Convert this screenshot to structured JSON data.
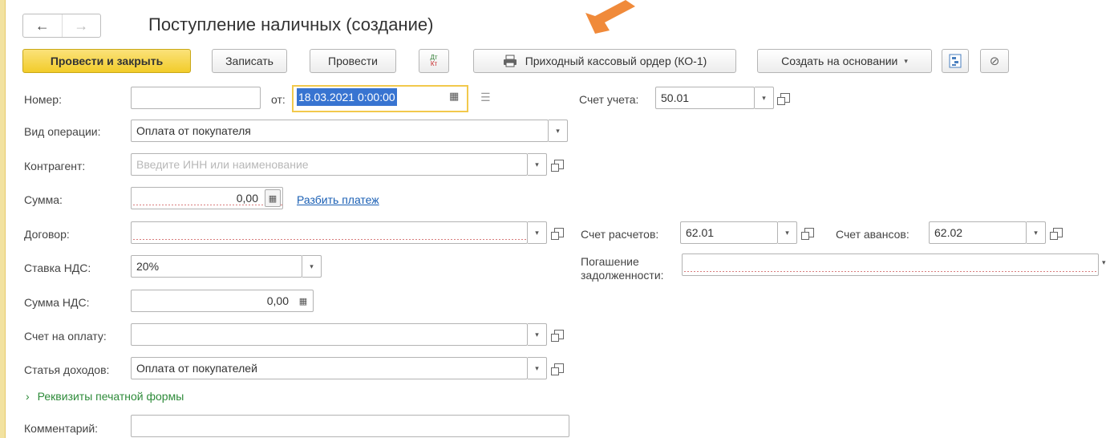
{
  "window": {
    "title": "Поступление наличных (создание)"
  },
  "nav": {
    "back_glyph": "←",
    "forward_glyph": "→"
  },
  "toolbar": {
    "post_close": "Провести и закрыть",
    "save": "Записать",
    "post": "Провести",
    "dt": "Дт",
    "kt": "Кт",
    "print": "Приходный кассовый ордер (КО-1)",
    "create_based": "Создать на основании"
  },
  "form": {
    "number_label": "Номер:",
    "number_value": "",
    "from_label": "от:",
    "date_value": "18.03.2021  0:00:00",
    "account_label": "Счет учета:",
    "account_value": "50.01",
    "op_type_label": "Вид операции:",
    "op_type_value": "Оплата от покупателя",
    "counterparty_label": "Контрагент:",
    "counterparty_placeholder": "Введите ИНН или наименование",
    "sum_label": "Сумма:",
    "sum_value": "0,00",
    "split_link": "Разбить платеж",
    "contract_label": "Договор:",
    "contract_value": "",
    "settle_acc_label": "Счет расчетов:",
    "settle_acc_value": "62.01",
    "advance_acc_label": "Счет авансов:",
    "advance_acc_value": "62.02",
    "vat_rate_label": "Ставка НДС:",
    "vat_rate_value": "20%",
    "debt_label_1": "Погашение",
    "debt_label_2": "задолженности:",
    "debt_value": "",
    "vat_sum_label": "Сумма НДС:",
    "vat_sum_value": "0,00",
    "invoice_label": "Счет на оплату:",
    "invoice_value": "",
    "income_label": "Статья доходов:",
    "income_value": "Оплата от покупателей",
    "print_details": "Реквизиты печатной формы",
    "comment_label": "Комментарий:",
    "comment_value": ""
  },
  "colors": {
    "accent": "#f2cc2a",
    "link": "#1a5fb4",
    "arrow": "#f08a3a",
    "section": "#2e8b3a"
  }
}
